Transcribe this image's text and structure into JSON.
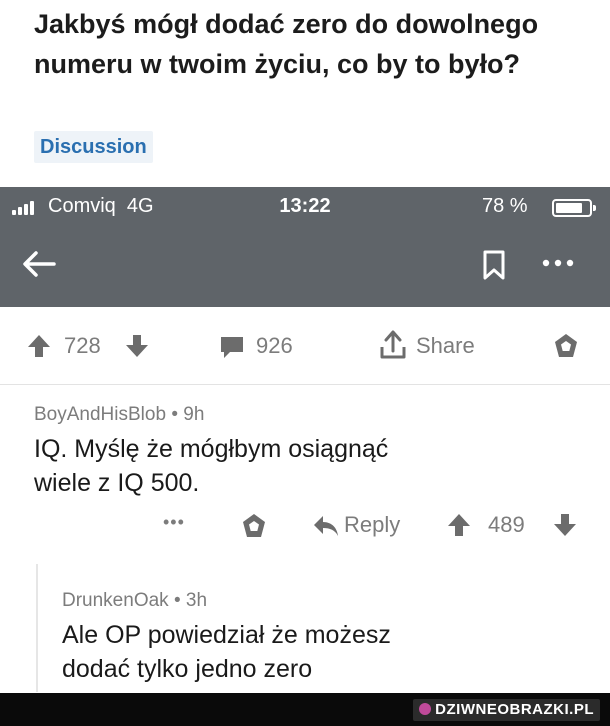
{
  "post": {
    "title": "Jakbyś mógł dodać zero do dowolnego numeru w twoim życiu, co by to było?",
    "flair": "Discussion"
  },
  "status_bar": {
    "carrier": "Comviq",
    "network": "4G",
    "time": "13:22",
    "battery": "78 %",
    "battery_level": 0.78
  },
  "post_actions": {
    "upvotes": "728",
    "comments": "926",
    "share_label": "Share"
  },
  "comments": [
    {
      "author": "BoyAndHisBlob",
      "age": "9h",
      "body_line1": "IQ. Myślę że mógłbym osiągnąć",
      "body_line2": "wiele z IQ 500.",
      "more": "•••",
      "reply_label": "Reply",
      "votes": "489"
    },
    {
      "author": "DrunkenOak",
      "age": "3h",
      "body_line1": "Ale OP powiedział że możesz",
      "body_line2": "dodać tylko jedno zero"
    }
  ],
  "separator": "•",
  "watermark": "DZIWNEOBRAZKI.PL",
  "colors": {
    "nav_bar": "#5f6469",
    "flair_text": "#2a6fb0",
    "muted": "#7c7c7c"
  }
}
